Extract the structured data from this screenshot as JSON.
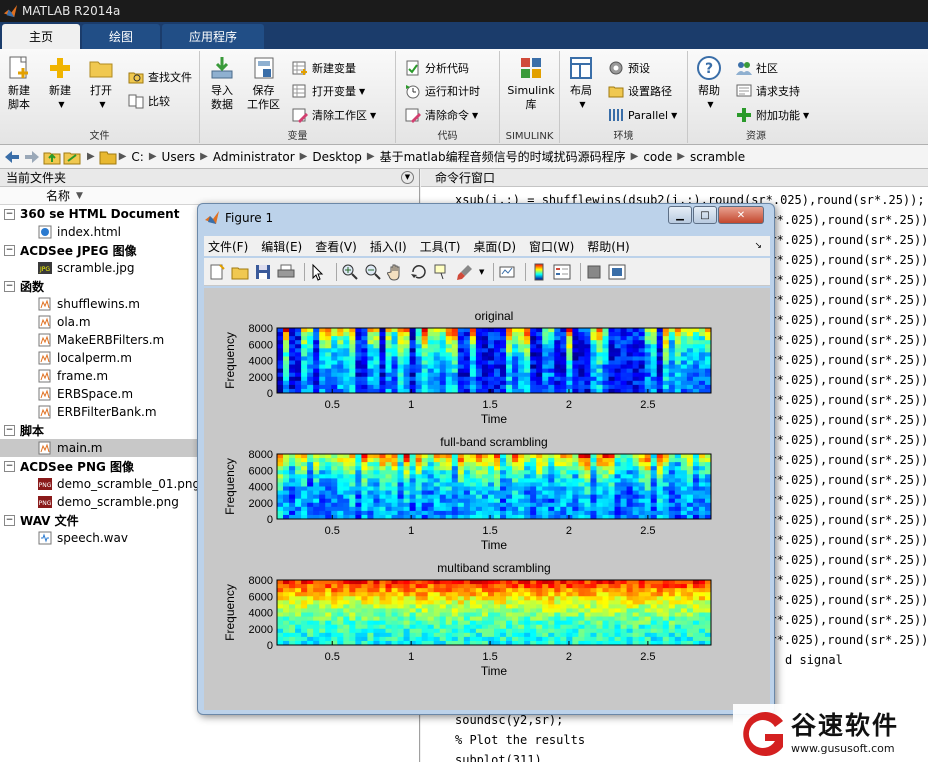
{
  "window": {
    "title": "MATLAB R2014a"
  },
  "tabs": [
    "主页",
    "绘图",
    "应用程序"
  ],
  "ribbon": {
    "file": {
      "label": "文件",
      "new_script": "新建\n脚本",
      "new": "新建",
      "open": "打开",
      "find_files": "查找文件",
      "compare": "比较"
    },
    "variable": {
      "label": "变量",
      "import": "导入\n数据",
      "save_workspace": "保存\n工作区",
      "new_variable": "新建变量",
      "open_variable": "打开变量",
      "clear_workspace": "清除工作区"
    },
    "code": {
      "label": "代码",
      "analyze": "分析代码",
      "run_time": "运行和计时",
      "clear_commands": "清除命令"
    },
    "simulink": {
      "label": "SIMULINK",
      "library": "Simulink\n库"
    },
    "environment": {
      "label": "环境",
      "layout": "布局",
      "preferences": "预设",
      "set_path": "设置路径",
      "parallel": "Parallel"
    },
    "resources": {
      "label": "资源",
      "help": "帮助",
      "community": "社区",
      "request_support": "请求支持",
      "addons": "附加功能"
    }
  },
  "address": {
    "path": [
      "C:",
      "Users",
      "Administrator",
      "Desktop",
      "基于matlab编程音频信号的时域扰码源码程序",
      "code",
      "scramble"
    ]
  },
  "current_folder": {
    "title": "当前文件夹",
    "column_name": "名称",
    "groups": [
      {
        "name": "360 se HTML Document",
        "files": [
          "index.html"
        ]
      },
      {
        "name": "ACDSee JPEG 图像",
        "files": [
          "scramble.jpg"
        ]
      },
      {
        "name": "函数",
        "files": [
          "shufflewins.m",
          "ola.m",
          "MakeERBFilters.m",
          "localperm.m",
          "frame.m",
          "ERBSpace.m",
          "ERBFilterBank.m"
        ]
      },
      {
        "name": "脚本",
        "files": [
          "main.m"
        ]
      },
      {
        "name": "ACDSee PNG 图像",
        "files": [
          "demo_scramble_01.png",
          "demo_scramble.png"
        ]
      },
      {
        "name": "WAV 文件",
        "files": [
          "speech.wav"
        ]
      }
    ],
    "selected": "main.m"
  },
  "command_window": {
    "title": "命令行窗口",
    "first_line": "xsub(i,:) = shufflewins(dsub2(i,:),round(sr*.025),round(sr*.25));",
    "repeated_tail": "(sr*.025),round(sr*.25));",
    "fragment_line": "d signal",
    "bottom_lines": [
      "soundsc(y2,sr);",
      "% Plot the results",
      "subplot(311)"
    ]
  },
  "figure": {
    "title": "Figure 1",
    "menu": [
      "文件(F)",
      "编辑(E)",
      "查看(V)",
      "插入(I)",
      "工具(T)",
      "桌面(D)",
      "窗口(W)",
      "帮助(H)"
    ],
    "plots": [
      {
        "title": "original",
        "xlabel": "Time",
        "ylabel": "Frequency"
      },
      {
        "title": "full-band scrambling",
        "xlabel": "Time",
        "ylabel": "Frequency"
      },
      {
        "title": "multiband scrambling",
        "xlabel": "Time",
        "ylabel": "Frequency"
      }
    ],
    "yticks": [
      "8000",
      "6000",
      "4000",
      "2000",
      "0"
    ],
    "xticks": [
      "0.5",
      "1",
      "1.5",
      "2",
      "2.5"
    ]
  },
  "watermark": {
    "brand": "谷速软件",
    "url": "www.gususoft.com"
  },
  "colors": {
    "titlebar": "#1b1b1b",
    "tabstrip": "#1b3c6b",
    "figure_frame": "#bcd2ea",
    "figure_bg": "#c8c8c8",
    "jet_low": "#00008f",
    "jet_high": "#ff0000"
  }
}
